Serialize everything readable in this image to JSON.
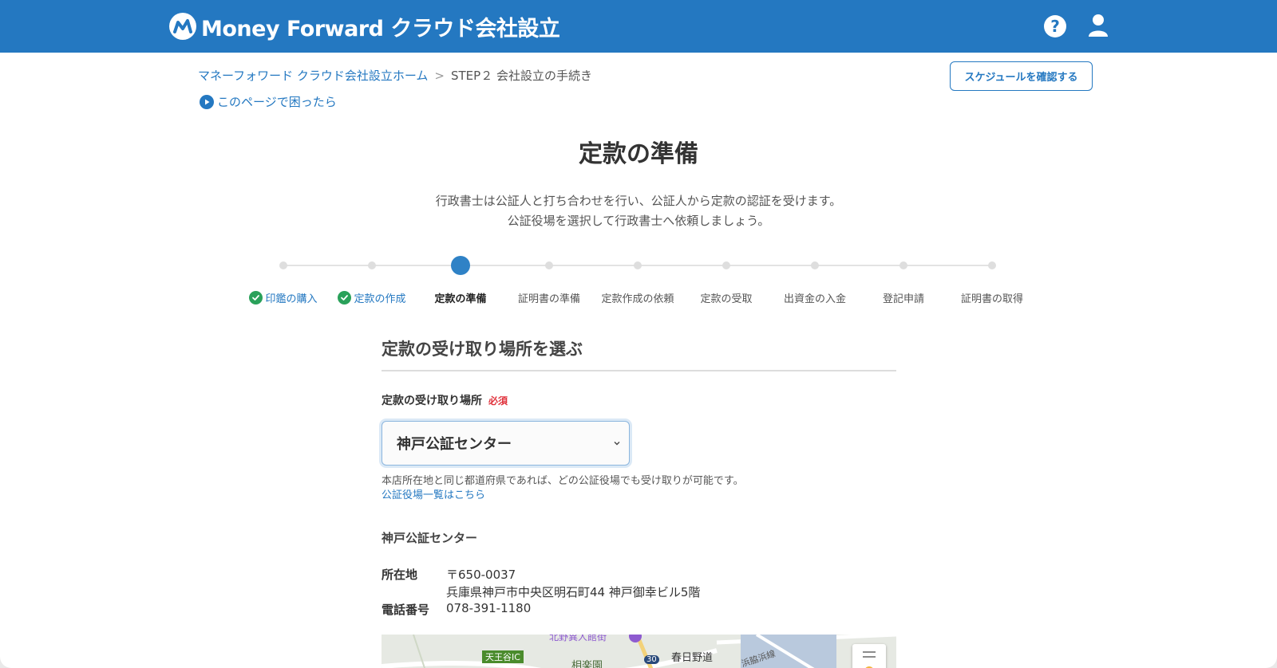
{
  "header": {
    "logo_text": "Money Forward クラウド会社設立",
    "help_icon_glyph": "?"
  },
  "breadcrumb": {
    "home": "マネーフォワード クラウド会社設立ホーム",
    "separator": ">",
    "current": "STEP２ 会社設立の手続き"
  },
  "help_link": "このページで困ったら",
  "schedule_button": "スケジュールを確認する",
  "page_title": "定款の準備",
  "lead": {
    "line1": "行政書士は公証人と打ち合わせを行い、公証人から定款の認証を受けます。",
    "line2": "公証役場を選択して行政書士へ依頼しましょう。"
  },
  "steps": [
    {
      "label": "印鑑の購入",
      "state": "done"
    },
    {
      "label": "定款の作成",
      "state": "done"
    },
    {
      "label": "定款の準備",
      "state": "current"
    },
    {
      "label": "証明書の準備",
      "state": "todo"
    },
    {
      "label": "定款作成の依頼",
      "state": "todo"
    },
    {
      "label": "定款の受取",
      "state": "todo"
    },
    {
      "label": "出資金の入金",
      "state": "todo"
    },
    {
      "label": "登記申請",
      "state": "todo"
    },
    {
      "label": "証明書の取得",
      "state": "todo"
    }
  ],
  "section": {
    "title": "定款の受け取り場所を選ぶ",
    "field_label": "定款の受け取り場所",
    "required": "必須",
    "selected_office": "神戸公証センター",
    "hint": "本店所在地と同じ都道府県であれば、どの公証役場でも受け取りが可能です。",
    "list_link": "公証役場一覧はこちら"
  },
  "office": {
    "name": "神戸公証センター",
    "address_label": "所在地",
    "postal": "〒650-0037",
    "address": "兵庫県神戸市中央区明石町44 神戸御幸ビル5階",
    "phone_label": "電話番号",
    "phone": "078-391-1180"
  },
  "map": {
    "label_ic": "天王谷IC",
    "label_kasuganomichi": "春日野道",
    "label_sorakuen": "相楽園",
    "route_number": "30",
    "label_line": "浜脇浜線",
    "label_top": "北野異人館街"
  },
  "colors": {
    "brand": "#2478c1",
    "success": "#2aa15a",
    "required": "#e0323c"
  }
}
